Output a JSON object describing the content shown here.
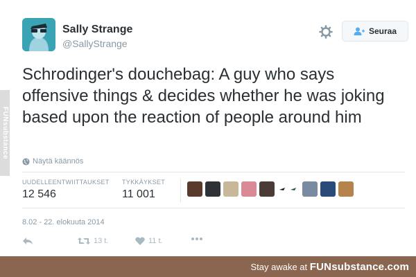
{
  "watermark_side": "FUNsubstance",
  "tweet": {
    "author_name": "Sally Strange",
    "author_handle": "@SallyStrange",
    "follow_label": "Seuraa",
    "text": "Schrodinger's douchebag: A guy who says offensive things & decides whether he was joking based upon the reaction of people around him",
    "translate_label": "Näytä käännös",
    "stats": {
      "retweets_label": "UUDELLEENTWIITTAUKSET",
      "retweets_value": "12 546",
      "likes_label": "TYKKÄYKSET",
      "likes_value": "11 001"
    },
    "timestamp": "8.02 - 22. elokuuta 2014",
    "actions": {
      "retweet_count": "13 t.",
      "like_count": "11 t."
    }
  },
  "footer": {
    "prefix": "Stay awake at ",
    "brand": "FUNsubstance.com"
  },
  "colors": {
    "text": "#292f33",
    "muted": "#8899a6",
    "border": "#e1e8ed",
    "avatar_bg": "#3aa4b5",
    "footer_bg": "#8a6650"
  },
  "icons": [
    "gear-icon",
    "follow-user-icon",
    "globe-icon",
    "reply-icon",
    "retweet-icon",
    "heart-icon",
    "more-icon"
  ]
}
